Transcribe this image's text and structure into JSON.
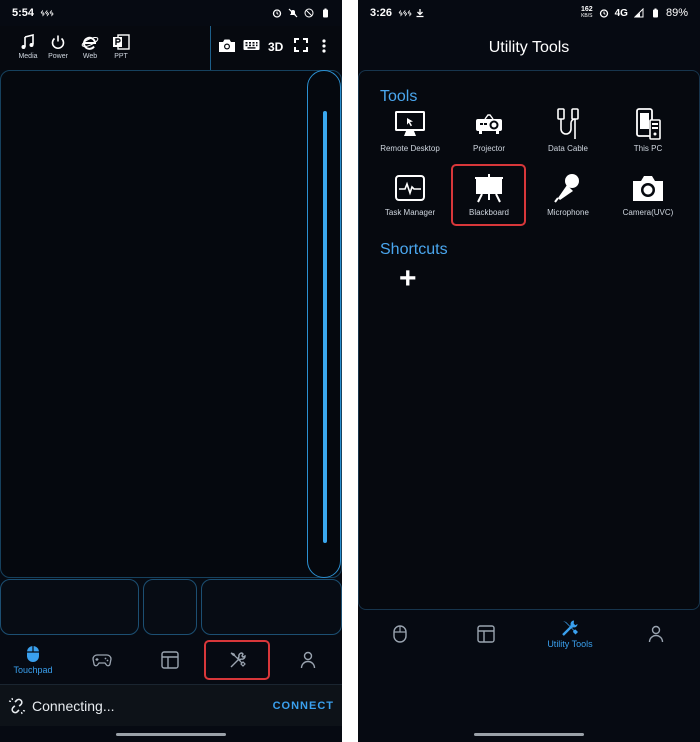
{
  "left": {
    "status": {
      "time": "5:54",
      "extra": "ᛃᛃᛃ"
    },
    "toolbar": {
      "items": [
        {
          "label": "Media",
          "icon": "music-note-icon"
        },
        {
          "label": "Power",
          "icon": "power-icon"
        },
        {
          "label": "Web",
          "icon": "ie-browser-icon"
        },
        {
          "label": "PPT",
          "icon": "powerpoint-icon"
        }
      ],
      "right": {
        "camera": "camera-icon",
        "keyboard": "keyboard-icon",
        "threed": "3D",
        "fullscreen": "fullscreen-icon",
        "more": "more-icon"
      }
    },
    "nav": {
      "touchpad": "Touchpad"
    },
    "connect": {
      "status": "Connecting...",
      "button": "CONNECT"
    }
  },
  "right": {
    "status": {
      "time": "3:26",
      "extra": "ᛃᛃᛃ",
      "speed_value": "162",
      "speed_unit": "KB/S",
      "network": "4G",
      "battery": "89%"
    },
    "title": "Utility Tools",
    "tools_header": "Tools",
    "tools": [
      {
        "label": "Remote Desktop",
        "icon": "monitor-icon"
      },
      {
        "label": "Projector",
        "icon": "projector-icon"
      },
      {
        "label": "Data Cable",
        "icon": "usb-cable-icon"
      },
      {
        "label": "This PC",
        "icon": "pc-phone-icon"
      },
      {
        "label": "Task Manager",
        "icon": "pulse-monitor-icon"
      },
      {
        "label": "Blackboard",
        "icon": "blackboard-icon"
      },
      {
        "label": "Microphone",
        "icon": "microphone-icon"
      },
      {
        "label": "Camera(UVC)",
        "icon": "camera-icon"
      }
    ],
    "shortcuts_header": "Shortcuts",
    "add_label": "+",
    "nav": {
      "utility": "Utility Tools"
    }
  },
  "colors": {
    "accent": "#3aa0ee",
    "highlight": "#d8373a",
    "background": "#060a12"
  }
}
